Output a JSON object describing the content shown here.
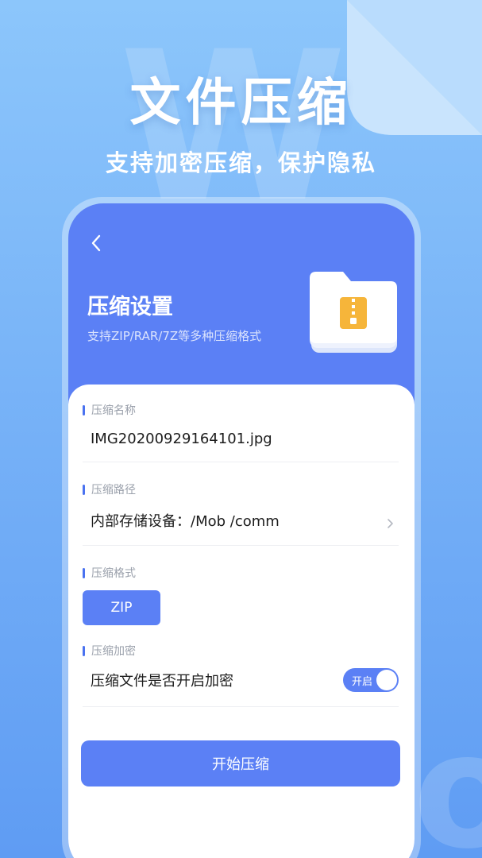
{
  "banner": {
    "title": "文件压缩",
    "subtitle": "支持加密压缩，保护隐私"
  },
  "screen": {
    "back_icon": "chevron-left-icon",
    "title": "压缩设置",
    "subtitle": "支持ZIP/RAR/7Z等多种压缩格式",
    "folder_icon": "zip-folder-icon"
  },
  "form": {
    "name": {
      "label": "压缩名称",
      "value": "IMG20200929164101.jpg"
    },
    "path": {
      "label": "压缩路径",
      "value": "内部存储设备：/Mob /comm",
      "arrow_icon": "chevron-right-icon"
    },
    "format": {
      "label": "压缩格式",
      "selected": "ZIP"
    },
    "encrypt": {
      "label": "压缩加密",
      "question": "压缩文件是否开启加密",
      "toggle_label": "开启",
      "enabled": true
    }
  },
  "start_button": "开始压缩",
  "colors": {
    "accent": "#5b80f5",
    "background_top": "#8cc6fb",
    "background_bottom": "#5f9cf3",
    "folder_zip": "#f6b53a"
  }
}
